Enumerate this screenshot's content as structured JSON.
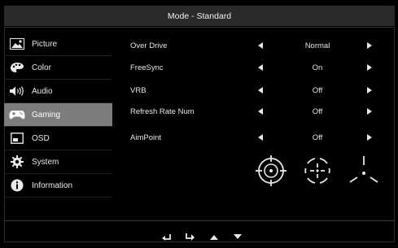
{
  "header": {
    "title": "Mode - Standard"
  },
  "sidebar": {
    "items": [
      {
        "label": "Picture",
        "icon": "picture-icon"
      },
      {
        "label": "Color",
        "icon": "palette-icon"
      },
      {
        "label": "Audio",
        "icon": "speaker-icon"
      },
      {
        "label": "Gaming",
        "icon": "gamepad-icon",
        "active": true
      },
      {
        "label": "OSD",
        "icon": "osd-icon"
      },
      {
        "label": "System",
        "icon": "gear-icon"
      },
      {
        "label": "Information",
        "icon": "info-icon"
      }
    ]
  },
  "settings": {
    "rows": [
      {
        "label": "Over Drive",
        "value": "Normal"
      },
      {
        "label": "FreeSync",
        "value": "On"
      },
      {
        "label": "VRB",
        "value": "Off"
      },
      {
        "label": "Refresh Rate Num",
        "value": "Off"
      },
      {
        "label": "AimPoint",
        "value": "Off"
      }
    ]
  },
  "aimpoint_options": [
    "crosshair-circle-icon",
    "crosshair-dashed-icon",
    "crosshair-tri-icon"
  ],
  "navigation": [
    "back-icon",
    "enter-icon",
    "up-arrow-icon",
    "down-arrow-icon"
  ],
  "colors": {
    "background": "#000000",
    "title_bar": "#2a2a2a",
    "active_item": "#7d7d7d",
    "text": "#e8e8e8"
  }
}
